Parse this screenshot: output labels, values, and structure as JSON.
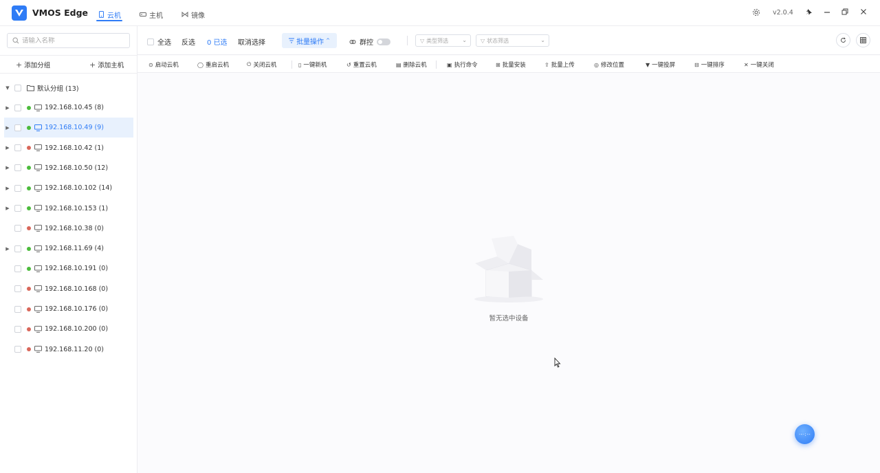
{
  "app": {
    "name": "VMOS Edge",
    "version": "v2.0.4"
  },
  "nav": {
    "tabs": [
      {
        "label": "云机"
      },
      {
        "label": "主机"
      },
      {
        "label": "镜像"
      }
    ]
  },
  "sidebar": {
    "search_placeholder": "请输入名称",
    "add_group": "添加分组",
    "add_host": "添加主机",
    "group": {
      "label": "默认分组 (13)"
    },
    "hosts": [
      {
        "label": "192.168.10.45 (8)",
        "status": "online",
        "expandable": true
      },
      {
        "label": "192.168.10.49 (9)",
        "status": "online",
        "expandable": true,
        "selected": true
      },
      {
        "label": "192.168.10.42 (1)",
        "status": "offline",
        "expandable": true
      },
      {
        "label": "192.168.10.50 (12)",
        "status": "online",
        "expandable": true
      },
      {
        "label": "192.168.10.102 (14)",
        "status": "online",
        "expandable": true
      },
      {
        "label": "192.168.10.153 (1)",
        "status": "online",
        "expandable": true
      },
      {
        "label": "192.168.10.38 (0)",
        "status": "offline",
        "expandable": false
      },
      {
        "label": "192.168.11.69 (4)",
        "status": "online",
        "expandable": true
      },
      {
        "label": "192.168.10.191 (0)",
        "status": "online",
        "expandable": false
      },
      {
        "label": "192.168.10.168 (0)",
        "status": "offline",
        "expandable": false
      },
      {
        "label": "192.168.10.176 (0)",
        "status": "offline",
        "expandable": false
      },
      {
        "label": "192.168.10.200 (0)",
        "status": "offline",
        "expandable": false
      },
      {
        "label": "192.168.11.20 (0)",
        "status": "offline",
        "expandable": false
      }
    ]
  },
  "toolbar": {
    "select_all": "全选",
    "invert": "反选",
    "selected_count": "0 已选",
    "cancel_select": "取消选择",
    "batch_ops": "批量操作",
    "group_control": "群控",
    "type_filter_placeholder": "类型筛选",
    "status_filter_placeholder": "状态筛选"
  },
  "actions": [
    {
      "label": "启动云机",
      "icon": "play-circle-icon"
    },
    {
      "label": "重启云机",
      "icon": "restart-icon"
    },
    {
      "label": "关闭云机",
      "icon": "power-icon"
    },
    {
      "label": "一键新机",
      "icon": "new-device-icon"
    },
    {
      "label": "重置云机",
      "icon": "reset-icon"
    },
    {
      "label": "删除云机",
      "icon": "trash-icon"
    },
    {
      "label": "执行命令",
      "icon": "terminal-icon"
    },
    {
      "label": "批量安装",
      "icon": "grid-icon"
    },
    {
      "label": "批量上传",
      "icon": "upload-icon"
    },
    {
      "label": "修改位置",
      "icon": "location-icon"
    },
    {
      "label": "一键投屏",
      "icon": "cast-icon"
    },
    {
      "label": "一键排序",
      "icon": "sort-icon"
    },
    {
      "label": "一键关闭",
      "icon": "close-icon"
    }
  ],
  "empty_state": {
    "text": "暂无选中设备"
  },
  "colors": {
    "accent": "#2f7cf6",
    "online": "#4cbb3c",
    "offline": "#d9675a"
  }
}
